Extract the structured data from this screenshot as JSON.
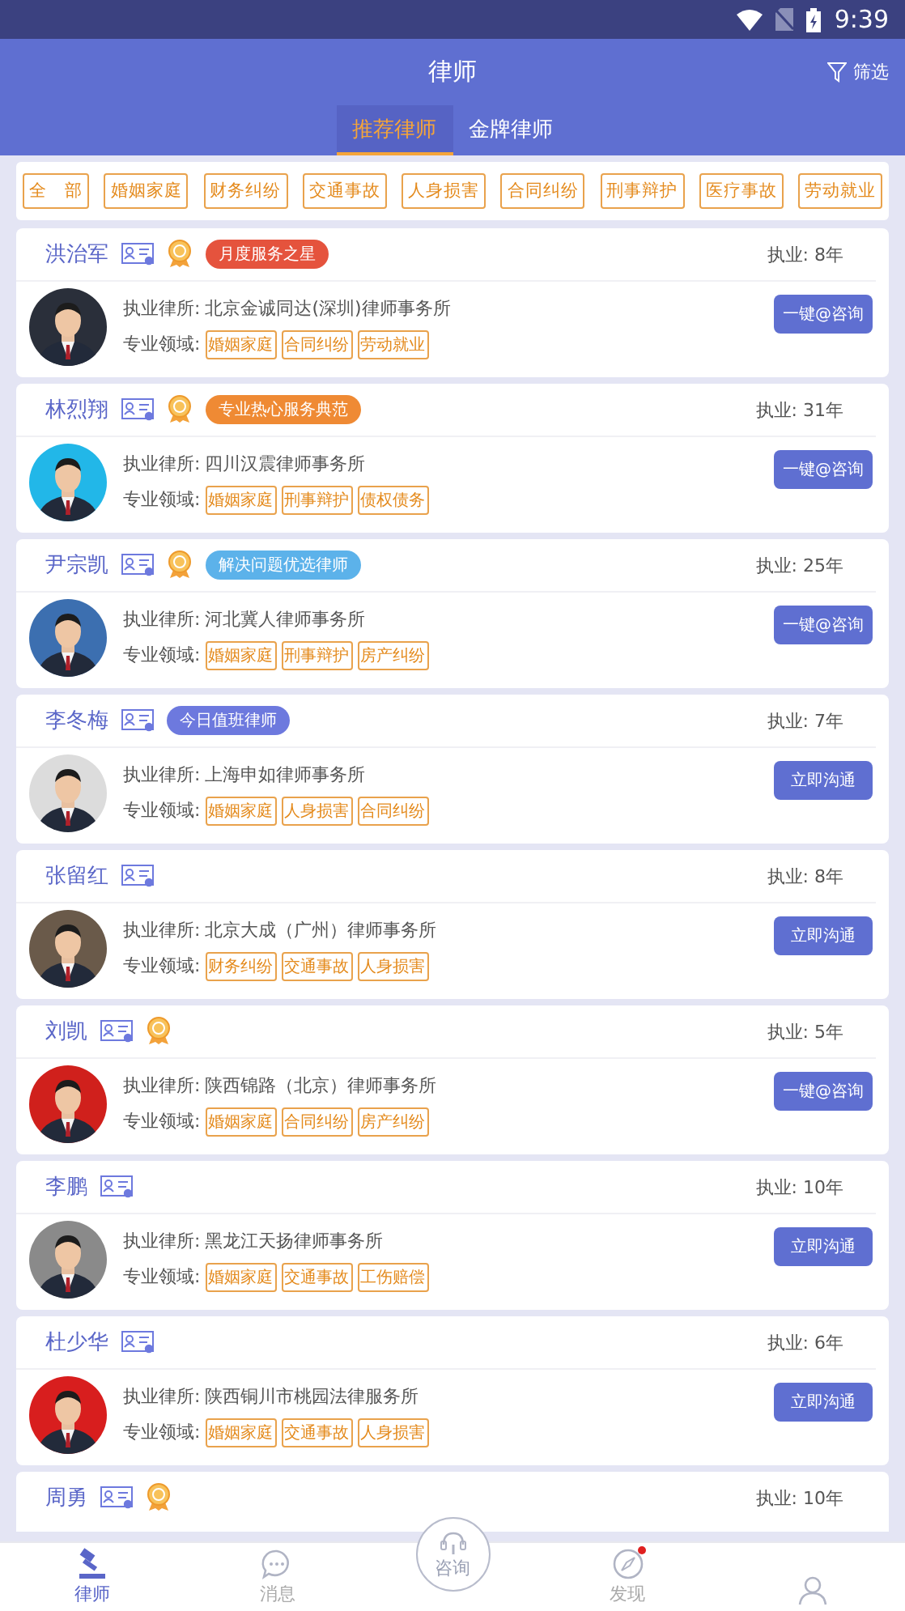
{
  "status_bar": {
    "time": "9:39"
  },
  "header": {
    "title": "律师",
    "filter": "筛选"
  },
  "tabs": [
    {
      "label": "推荐律师",
      "selected": true
    },
    {
      "label": "金牌律师",
      "selected": false
    }
  ],
  "categories": [
    "全　部",
    "婚姻家庭",
    "财务纠纷",
    "交通事故",
    "人身损害",
    "合同纠纷",
    "刑事辩护",
    "医疗事故",
    "劳动就业"
  ],
  "lawyers": [
    {
      "name": "洪治军",
      "medal": true,
      "badge": {
        "text": "月度服务之星",
        "color": "#e5533d"
      },
      "years": "执业: 8年",
      "firm_label": "执业律所:",
      "firm": "北京金诚同达(深圳)律师事务所",
      "field_label": "专业领域:",
      "tags": [
        "婚姻家庭",
        "合同纠纷",
        "劳动就业"
      ],
      "button": "一键@咨询"
    },
    {
      "name": "林烈翔",
      "medal": true,
      "badge": {
        "text": "专业热心服务典范",
        "color": "#ef8a34"
      },
      "years": "执业: 31年",
      "firm_label": "执业律所:",
      "firm": "四川汉震律师事务所",
      "field_label": "专业领域:",
      "tags": [
        "婚姻家庭",
        "刑事辩护",
        "债权债务"
      ],
      "button": "一键@咨询"
    },
    {
      "name": "尹宗凯",
      "medal": true,
      "badge": {
        "text": "解决问题优选律师",
        "color": "#5cb2ea"
      },
      "years": "执业: 25年",
      "firm_label": "执业律所:",
      "firm": "河北冀人律师事务所",
      "field_label": "专业领域:",
      "tags": [
        "婚姻家庭",
        "刑事辩护",
        "房产纠纷"
      ],
      "button": "一键@咨询"
    },
    {
      "name": "李冬梅",
      "badge": {
        "text": "今日值班律师",
        "color": "#6d79de"
      },
      "years": "执业: 7年",
      "firm_label": "执业律所:",
      "firm": "上海申如律师事务所",
      "field_label": "专业领域:",
      "tags": [
        "婚姻家庭",
        "人身损害",
        "合同纠纷"
      ],
      "button": "立即沟通"
    },
    {
      "name": "张留红",
      "years": "执业: 8年",
      "firm_label": "执业律所:",
      "firm": "北京大成（广州）律师事务所",
      "field_label": "专业领域:",
      "tags": [
        "财务纠纷",
        "交通事故",
        "人身损害"
      ],
      "button": "立即沟通"
    },
    {
      "name": "刘凯",
      "medal": true,
      "years": "执业: 5年",
      "firm_label": "执业律所:",
      "firm": "陕西锦路（北京）律师事务所",
      "field_label": "专业领域:",
      "tags": [
        "婚姻家庭",
        "合同纠纷",
        "房产纠纷"
      ],
      "button": "一键@咨询"
    },
    {
      "name": "李鹏",
      "years": "执业: 10年",
      "firm_label": "执业律所:",
      "firm": "黑龙江天扬律师事务所",
      "field_label": "专业领域:",
      "tags": [
        "婚姻家庭",
        "交通事故",
        "工伤赔偿"
      ],
      "button": "立即沟通"
    },
    {
      "name": "杜少华",
      "years": "执业: 6年",
      "firm_label": "执业律所:",
      "firm": "陕西铜川市桃园法律服务所",
      "field_label": "专业领域:",
      "tags": [
        "婚姻家庭",
        "交通事故",
        "人身损害"
      ],
      "button": "立即沟通"
    },
    {
      "name": "周勇",
      "medal": true,
      "years": "执业: 10年"
    }
  ],
  "nav": [
    {
      "kind": "gavel",
      "label": "律师",
      "selected": true
    },
    {
      "kind": "chat",
      "label": "消息",
      "selected": false
    },
    {
      "kind": "center",
      "label": "咨询",
      "selected": false
    },
    {
      "kind": "compass",
      "label": "发现",
      "selected": false,
      "dot": true
    },
    {
      "kind": "person",
      "selected": false
    }
  ]
}
